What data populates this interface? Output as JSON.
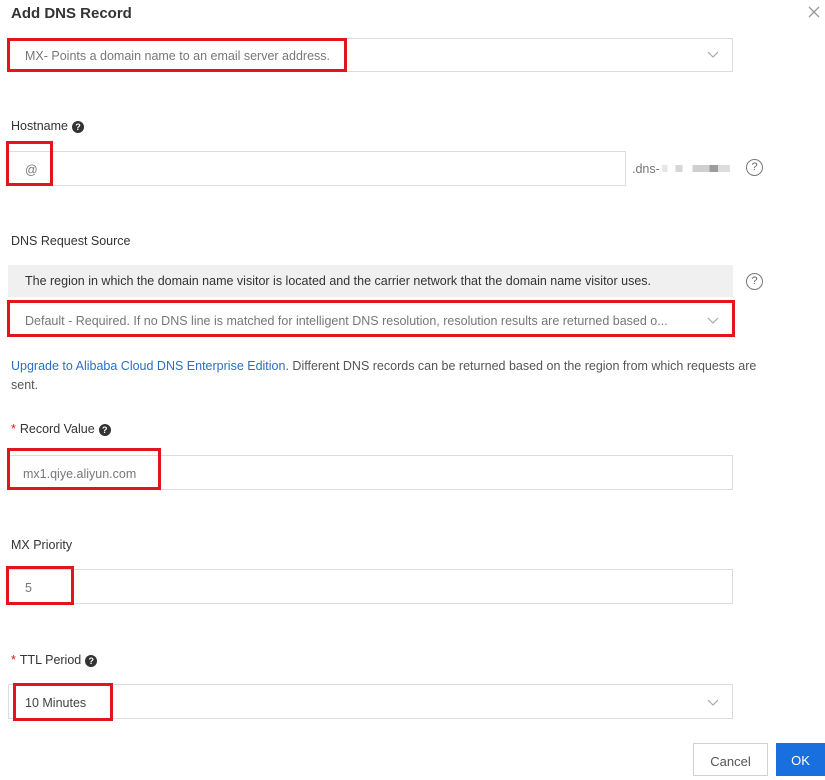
{
  "dialog": {
    "title": "Add DNS Record"
  },
  "record_type": {
    "value": "MX- Points a domain name to an email server address."
  },
  "hostname": {
    "label": "Hostname",
    "value": "@",
    "suffix": ".dns-"
  },
  "dns_request_source": {
    "label": "DNS Request Source",
    "info": "The region in which the domain name visitor is located and the carrier network that the domain name visitor uses.",
    "value": "Default - Required. If no DNS line is matched for intelligent DNS resolution, resolution results are returned based o..."
  },
  "upgrade": {
    "link": "Upgrade to Alibaba Cloud DNS Enterprise Edition",
    "text_line1": ". Different DNS records can be returned based on the region from which requests are",
    "text_line2": "sent."
  },
  "record_value": {
    "required_mark": "*",
    "label": "Record Value",
    "value": "mx1.qiye.aliyun.com"
  },
  "mx_priority": {
    "label": "MX Priority",
    "value": "5"
  },
  "ttl": {
    "required_mark": "*",
    "label": "TTL Period",
    "value": "10 Minutes"
  },
  "footer": {
    "cancel_label": "Cancel",
    "ok_label": "OK"
  },
  "colors": {
    "highlight": "#e4141c",
    "primary": "#1a6fde",
    "link": "#2a6fc6"
  }
}
